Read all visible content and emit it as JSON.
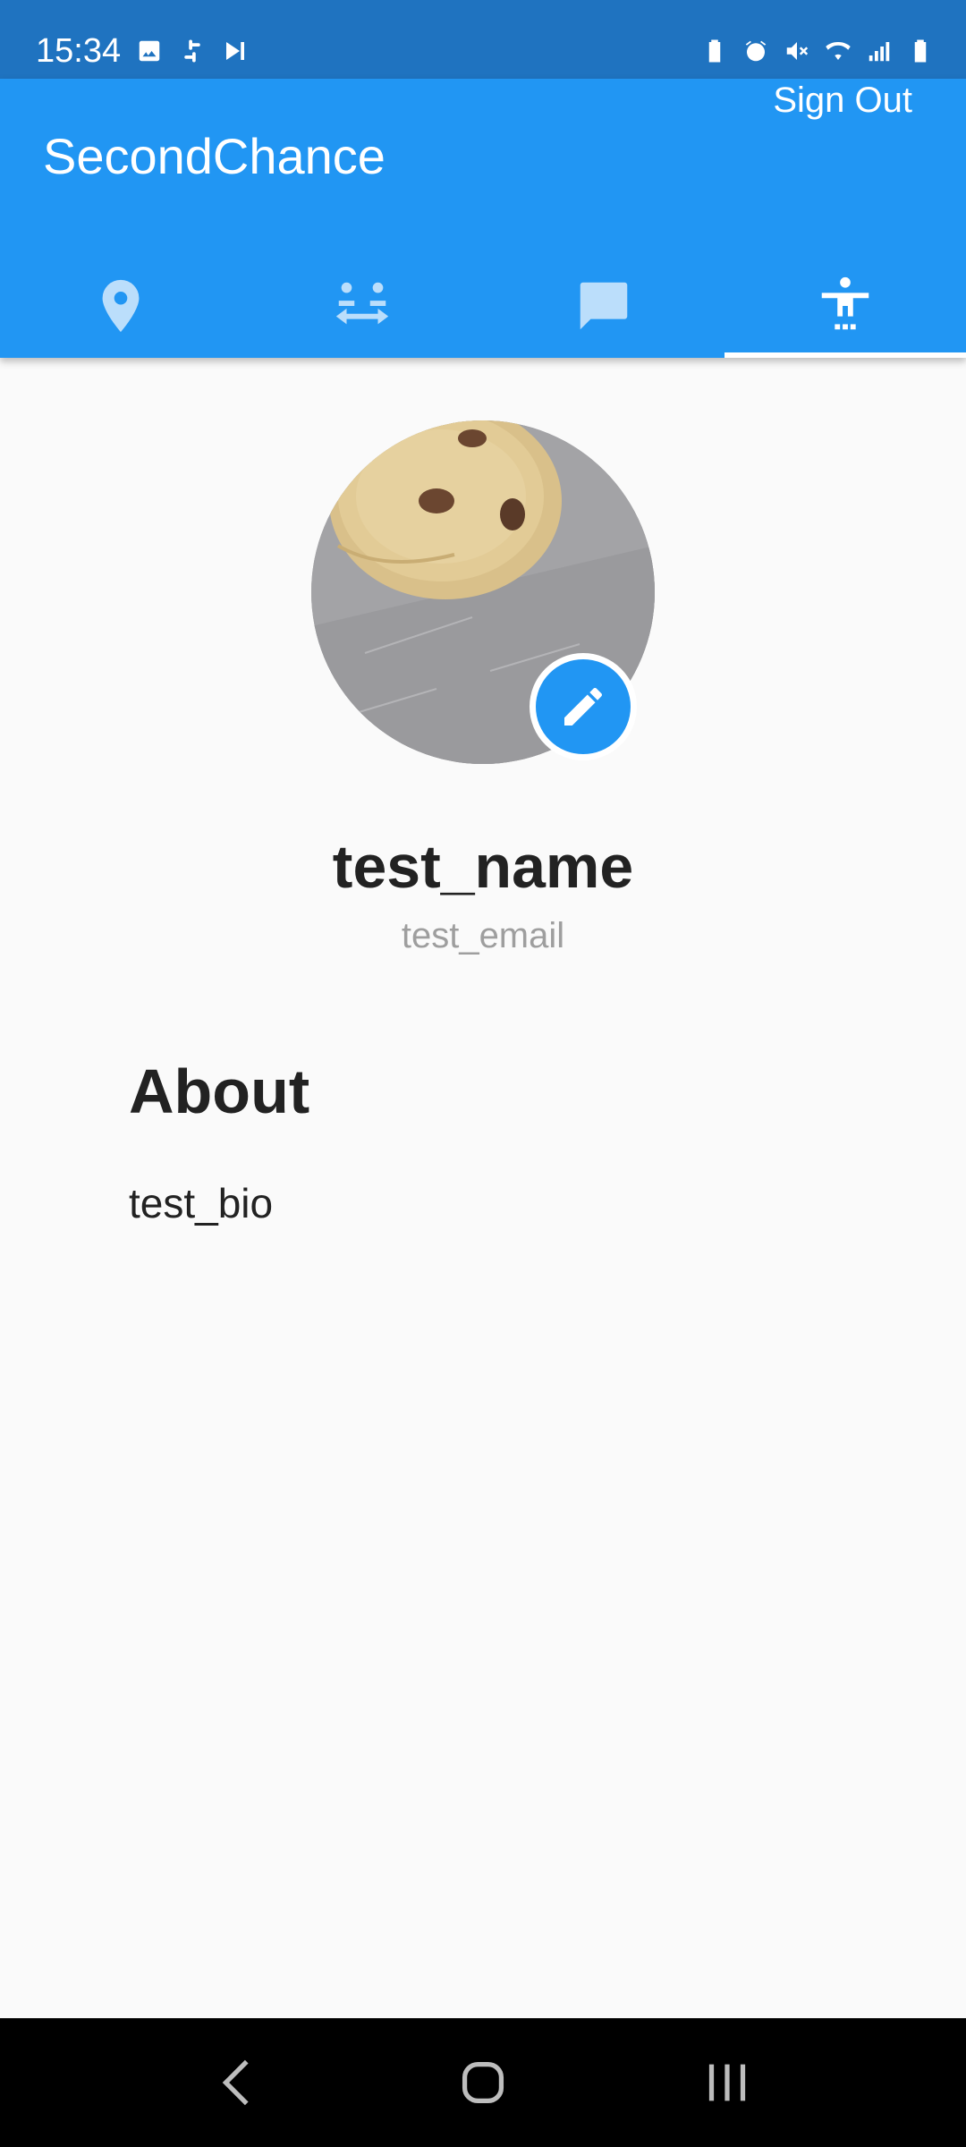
{
  "status_bar": {
    "time": "15:34",
    "left_icons": [
      "gallery-icon",
      "slack-icon",
      "media-play-icon"
    ],
    "right_icons": [
      "battery-saver-icon",
      "alarm-icon",
      "mute-icon",
      "wifi-icon",
      "signal-icon",
      "battery-icon"
    ]
  },
  "app_bar": {
    "title": "SecondChance",
    "sign_out_label": "Sign Out",
    "tabs": [
      {
        "icon": "location-pin-icon",
        "selected": false
      },
      {
        "icon": "people-exchange-icon",
        "selected": false
      },
      {
        "icon": "chat-icon",
        "selected": false
      },
      {
        "icon": "accessibility-person-icon",
        "selected": true
      }
    ],
    "colors": {
      "primary": "#2196f3",
      "status": "#1f73c0",
      "inactive_icon": "#bbdefb"
    }
  },
  "profile": {
    "avatar_alt": "cookie photo",
    "name": "test_name",
    "email": "test_email",
    "about_heading": "About",
    "bio": "test_bio"
  },
  "nav_bar": {
    "buttons": [
      "back-icon",
      "home-icon",
      "recents-icon"
    ]
  }
}
